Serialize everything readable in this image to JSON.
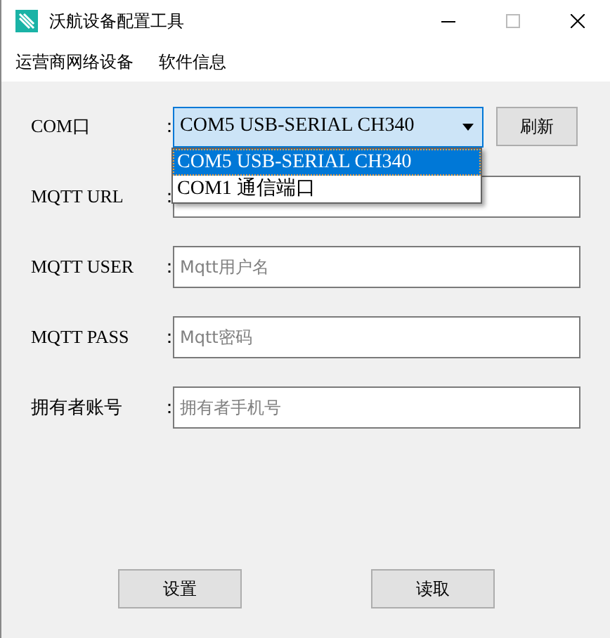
{
  "window": {
    "title": "沃航设备配置工具"
  },
  "menu": [
    "运营商网络设备",
    "软件信息"
  ],
  "com": {
    "label": "COM口",
    "separator": "：",
    "value": "COM5 USB-SERIAL CH340",
    "refresh": "刷新",
    "dropdown": [
      {
        "label": "COM5 USB-SERIAL CH340",
        "selected": true
      },
      {
        "label": "COM1 通信端口",
        "selected": false
      }
    ]
  },
  "fields": [
    {
      "label": "MQTT URL",
      "separator": "："
    },
    {
      "label": "MQTT USER",
      "separator": "：",
      "placeholder": "Mqtt用户名"
    },
    {
      "label": "MQTT PASS",
      "separator": "：",
      "placeholder": "Mqtt密码"
    },
    {
      "label": "拥有者账号",
      "separator": "：",
      "placeholder": "拥有者手机号"
    }
  ],
  "buttons": [
    "设置",
    "读取"
  ]
}
